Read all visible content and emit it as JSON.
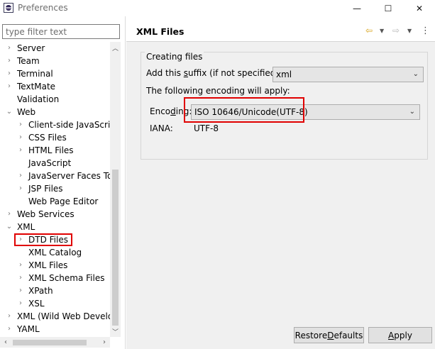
{
  "window": {
    "title": "Preferences",
    "minimize_glyph": "—",
    "maximize_glyph": "☐",
    "close_glyph": "✕"
  },
  "sidebar": {
    "filter_placeholder": "type filter text",
    "items": [
      {
        "label": "Server",
        "arrow": "›",
        "level": 0
      },
      {
        "label": "Team",
        "arrow": "›",
        "level": 0
      },
      {
        "label": "Terminal",
        "arrow": "›",
        "level": 0
      },
      {
        "label": "TextMate",
        "arrow": "›",
        "level": 0
      },
      {
        "label": "Validation",
        "arrow": "",
        "level": 0
      },
      {
        "label": "Web",
        "arrow": "⌄",
        "level": 0
      },
      {
        "label": "Client-side JavaScript",
        "arrow": "›",
        "level": 1
      },
      {
        "label": "CSS Files",
        "arrow": "›",
        "level": 1
      },
      {
        "label": "HTML Files",
        "arrow": "›",
        "level": 1
      },
      {
        "label": "JavaScript",
        "arrow": "",
        "level": 1
      },
      {
        "label": "JavaServer Faces Tools",
        "arrow": "›",
        "level": 1
      },
      {
        "label": "JSP Files",
        "arrow": "›",
        "level": 1
      },
      {
        "label": "Web Page Editor",
        "arrow": "",
        "level": 1
      },
      {
        "label": "Web Services",
        "arrow": "›",
        "level": 0
      },
      {
        "label": "XML",
        "arrow": "⌄",
        "level": 0
      },
      {
        "label": "DTD Files",
        "arrow": "›",
        "level": 1
      },
      {
        "label": "XML Catalog",
        "arrow": "",
        "level": 1
      },
      {
        "label": "XML Files",
        "arrow": "›",
        "level": 1
      },
      {
        "label": "XML Schema Files",
        "arrow": "›",
        "level": 1
      },
      {
        "label": "XPath",
        "arrow": "›",
        "level": 1
      },
      {
        "label": "XSL",
        "arrow": "›",
        "level": 1
      },
      {
        "label": "XML (Wild Web Developer)",
        "arrow": "›",
        "level": 0
      },
      {
        "label": "YAML",
        "arrow": "›",
        "level": 0
      }
    ]
  },
  "page": {
    "title": "XML Files",
    "group_title": "Creating files",
    "suffix_label_pre": "Add this ",
    "suffix_label_mnemonic": "s",
    "suffix_label_post": "uffix (if not specified):",
    "suffix_value": "xml",
    "encoding_intro": "The following encoding will apply:",
    "encoding_label_pre": "Enco",
    "encoding_label_mnemonic": "d",
    "encoding_label_post": "ing:",
    "encoding_value": "ISO 10646/Unicode(UTF-8)",
    "iana_label": "IANA:",
    "iana_value": "UTF-8"
  },
  "buttons": {
    "restore_pre": "Restore ",
    "restore_mnemonic": "D",
    "restore_post": "efaults",
    "apply_mnemonic": "A",
    "apply_post": "pply"
  },
  "colors": {
    "highlight": "#e00000",
    "back_arrow": "#d7a31a"
  }
}
